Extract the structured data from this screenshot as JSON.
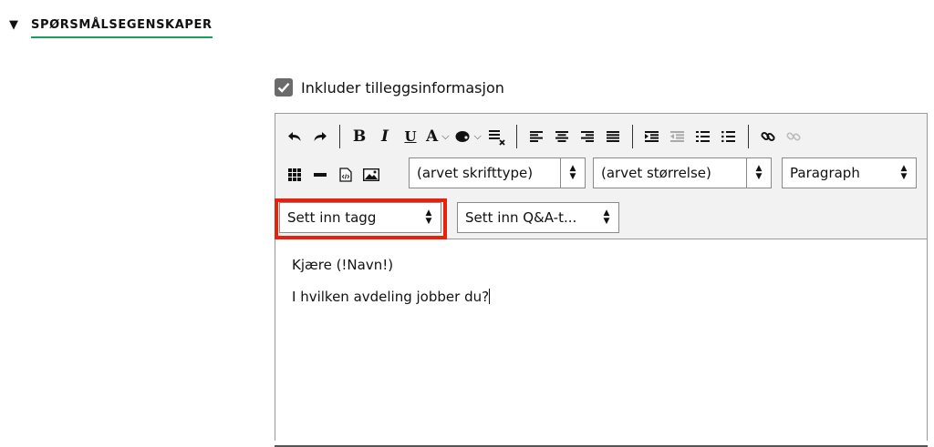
{
  "section": {
    "toggle": "▼",
    "title": "SPØRSMÅLSEGENSKAPER"
  },
  "checkbox": {
    "label": "Inkluder tilleggsinformasjon",
    "checked": true
  },
  "toolbar": {
    "bold": "B",
    "italic": "I",
    "underline": "U",
    "font_color": "A",
    "selects": {
      "font_family": "(arvet skrifttype)",
      "font_size": "(arvet størrelse)",
      "format": "Paragraph",
      "insert_tag": "Sett inn tagg",
      "insert_qa": "Sett inn Q&A-t..."
    }
  },
  "content": {
    "line1": "Kjære (!Navn!)",
    "line2": "I hvilken avdeling jobber du?"
  },
  "colors": {
    "accent_underline": "#1a9e5c",
    "highlight": "#e8210d",
    "checkbox": "#6b6b6b"
  }
}
